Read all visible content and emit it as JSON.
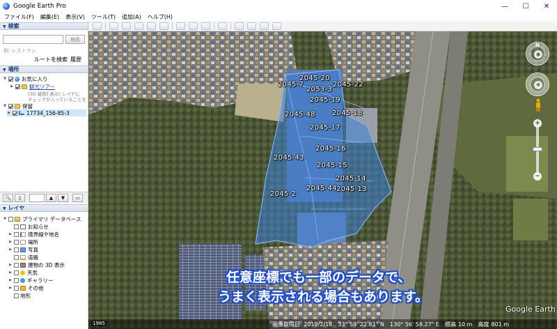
{
  "window": {
    "title": "Google Earth Pro",
    "minimize": "—",
    "maximize": "☐",
    "close": "✕"
  },
  "menu": {
    "items": [
      "ファイル(F)",
      "編集(E)",
      "表示(V)",
      "ツール(T)",
      "追加(A)",
      "ヘルプ(H)"
    ]
  },
  "search": {
    "header": "検索",
    "input_value": "",
    "button": "検索",
    "hint": "例: レストラン",
    "route": "ルートを検索",
    "history": "履歴"
  },
  "places": {
    "header": "場所",
    "favorites": "お気に入り",
    "tour": "観光ツアー",
    "tour_note_1": "[3D 建物] 表示] レイヤに",
    "tour_note_2": "チェックが入っていることを",
    "saved": "保留",
    "item": "17734_156-85-3"
  },
  "layers": {
    "header": "レイヤ",
    "root": "プライマリ データベース",
    "items": [
      "お知らせ",
      "境界線や地名",
      "場所",
      "写真",
      "道路",
      "建物の 3D 表示",
      "天気",
      "ギャラリー",
      "その他",
      "地形"
    ]
  },
  "parcels": [
    "2045-20",
    "2045-7",
    "2053-3",
    "2045-22",
    "2045-19",
    "2045-48",
    "2045-18",
    "2045-17",
    "2045-16",
    "2045-43",
    "2045-15",
    "2045-14",
    "2045-44",
    "2045-13",
    "2045-2"
  ],
  "caption": {
    "line1": "任意座標でも一部のデータで、",
    "line2": "うまく表示される場合もあります。"
  },
  "map": {
    "logo": "Google Earth",
    "year": "1985",
    "date": "画像取得日: 2019/2/18",
    "lat": "33° 59' 22.61\" N",
    "lon": "130° 56' 58.27\" E",
    "elev_label": "標高",
    "elev_value": "10 m",
    "alt_label": "高度",
    "alt_value": "801 m"
  },
  "colors": {
    "parcel_fill": "#3d7fd6",
    "caption_outline": "#1e4fd0"
  }
}
